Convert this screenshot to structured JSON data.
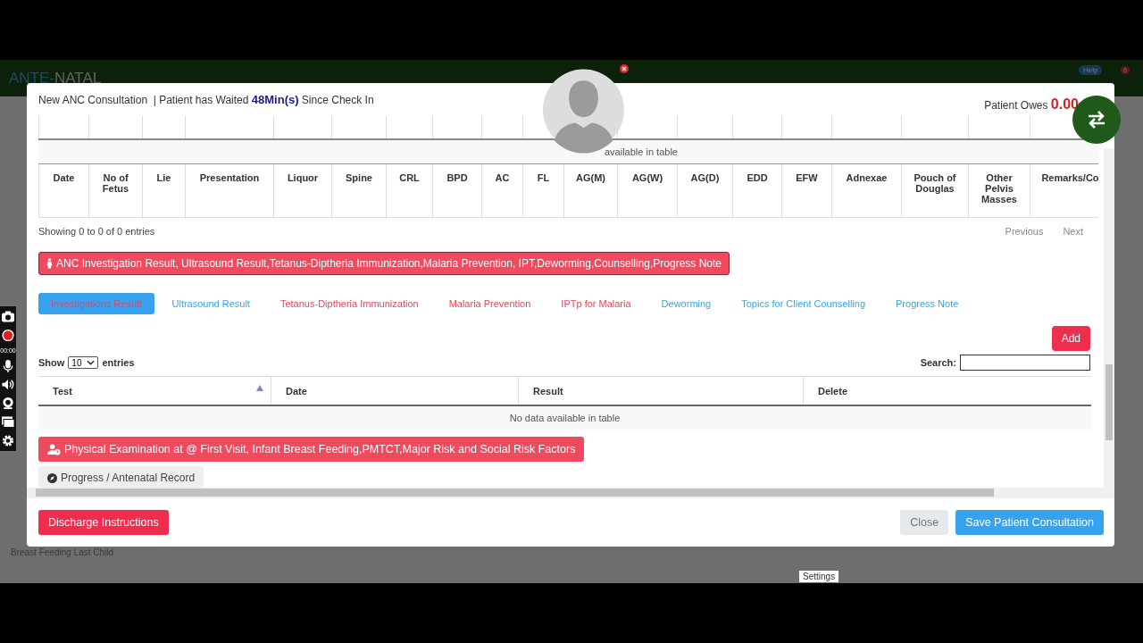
{
  "app": {
    "logo_left": "ANTE-",
    "logo_right": "NATAL",
    "help_badge": "Help",
    "notification_count": "6",
    "sidebar_item": "Breast Feeding Last Child"
  },
  "recorder": {
    "timer": "00:00"
  },
  "tooltip": "Settings",
  "modal": {
    "title": "New ANC Consultation",
    "wait_prefix": "| Patient has Waited",
    "wait_time": "48Min(s)",
    "wait_suffix": "Since Check In",
    "owes_label": "Patient Owes",
    "owes_amount": "0.00"
  },
  "upper_table": {
    "empty_text": "available in table"
  },
  "ultrasound_table": {
    "columns": [
      "Date",
      "No of Fetus",
      "Lie",
      "Presentation",
      "Liquor",
      "Spine",
      "CRL",
      "BPD",
      "AC",
      "FL",
      "AG(M)",
      "AG(W)",
      "AG(D)",
      "EDD",
      "EFW",
      "Adnexae",
      "Pouch of Douglas",
      "Other Pelvis Masses",
      "Remarks/Co"
    ],
    "info": "Showing 0 to 0 of 0 entries",
    "previous": "Previous",
    "next": "Next"
  },
  "section_button": "ANC Investigation Result, Ultrasound Result,Tetanus-Diptheria Immunization,Malaria Prevention, IPT,Deworming,Counselling,Progress Note",
  "tabs": [
    {
      "label": "Investigations Result",
      "selected": true
    },
    {
      "label": "Ultrasound Result",
      "selected": false,
      "color": "#3ea3dc"
    },
    {
      "label": "Tetanus-Diptheria Immunization",
      "selected": false,
      "color": "#e0475a"
    },
    {
      "label": "Malaria Prevention",
      "selected": false,
      "color": "#e0475a"
    },
    {
      "label": "IPTp for Malaria",
      "selected": false,
      "color": "#e0475a"
    },
    {
      "label": "Deworming",
      "selected": false,
      "color": "#3ea3dc"
    },
    {
      "label": "Topics for Client Counselling",
      "selected": false,
      "color": "#3ea3dc"
    },
    {
      "label": "Progress Note",
      "selected": false,
      "color": "#3ea3dc"
    }
  ],
  "add_button": "Add",
  "length": {
    "show": "Show",
    "value": "10",
    "entries": "entries"
  },
  "search": {
    "label": "Search:"
  },
  "results_table": {
    "columns": [
      {
        "label": "Test",
        "sorted": true
      },
      {
        "label": "Date",
        "sorted": false
      },
      {
        "label": "Result",
        "sorted": false
      },
      {
        "label": "Delete",
        "sorted": false
      }
    ],
    "empty_text": "No data available in table"
  },
  "physical_button": "Physical Examination at @ First Visit, Infant Breast Feeding,PMTCT,Major Risk and Social Risk Factors",
  "progress_tab": "Progress / Antenatal Record",
  "footer": {
    "discharge": "Discharge Instructions",
    "close": "Close",
    "save": "Save Patient Consultation"
  }
}
